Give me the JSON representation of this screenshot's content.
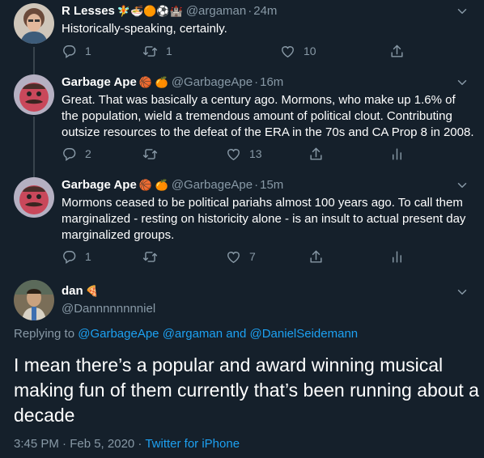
{
  "tweets": [
    {
      "name": "R Lesses",
      "emoji": "🧚🍜🟠⚽🏰",
      "handle": "@argaman",
      "time": "24m",
      "text": "Historically-speaking, certainly.",
      "replies": "1",
      "retweets": "1",
      "likes": "10"
    },
    {
      "name": "Garbage Ape",
      "emoji": "🏀 🍊",
      "handle": "@GarbageApe",
      "time": "16m",
      "text": "Great. That was basically a century ago. Mormons, who make up 1.6% of the population, wield a tremendous amount of political clout. Contributing outsize resources to the defeat of the ERA in the 70s and CA Prop 8 in 2008.",
      "replies": "2",
      "retweets": "",
      "likes": "13"
    },
    {
      "name": "Garbage Ape",
      "emoji": "🏀 🍊",
      "handle": "@GarbageApe",
      "time": "15m",
      "text": "Mormons ceased to be political pariahs almost 100 years ago. To call them marginalized - resting on historicity alone - is an insult to actual present day marginalized groups.",
      "replies": "1",
      "retweets": "",
      "likes": "7"
    }
  ],
  "focus": {
    "name": "dan",
    "emoji": "🍕",
    "handle": "@Dannnnnnnniel",
    "replying_label": "Replying to",
    "replying_1": "@GarbageApe",
    "replying_2": "@argaman",
    "replying_and": "and",
    "replying_3": "@DanielSeidemann",
    "text": "I mean there’s a popular and award winning musical making fun of them currently that’s been running about a decade",
    "timestamp": "3:45 PM · Feb 5, 2020 · ",
    "source": "Twitter for iPhone"
  },
  "colors": {
    "background": "#15202b",
    "muted": "#8899a6",
    "accent": "#1da1f2",
    "thread_line": "#38444d"
  },
  "icons": [
    "chevron-down-icon",
    "reply-icon",
    "retweet-icon",
    "like-icon",
    "share-icon",
    "analytics-icon"
  ]
}
